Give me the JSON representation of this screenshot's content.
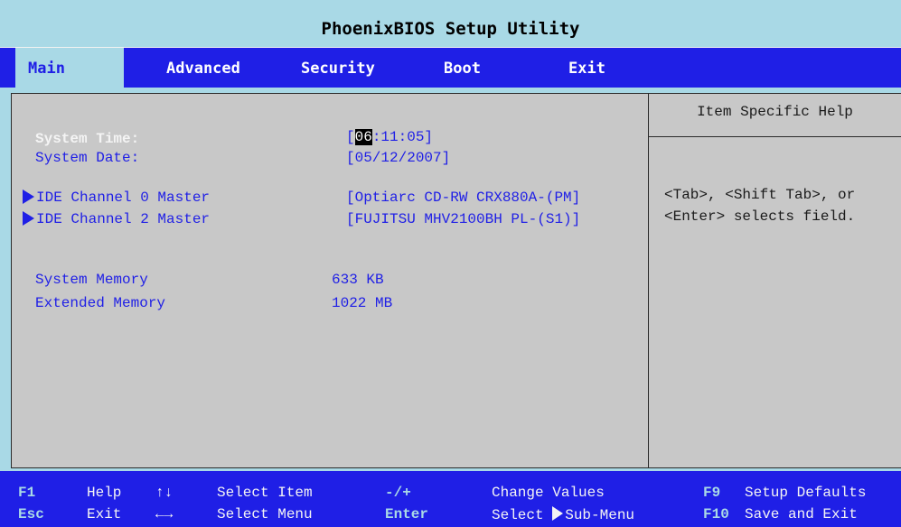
{
  "title": "PhoenixBIOS Setup Utility",
  "tabs": [
    {
      "label": "Main",
      "active": true
    },
    {
      "label": "Advanced",
      "active": false
    },
    {
      "label": "Security",
      "active": false
    },
    {
      "label": "Boot",
      "active": false
    },
    {
      "label": "Exit",
      "active": false
    }
  ],
  "settings": {
    "system_time": {
      "label": "System Time:",
      "open": "[",
      "cursor": "06",
      "rest": ":11:05]"
    },
    "system_date": {
      "label": "System Date:",
      "value": "[05/12/2007]"
    },
    "ide0": {
      "label": "IDE Channel 0 Master",
      "value": "[Optiarc CD-RW CRX880A-(PM]"
    },
    "ide2": {
      "label": "IDE Channel 2 Master",
      "value": "[FUJITSU MHV2100BH PL-(S1)]"
    },
    "system_memory": {
      "label": "System Memory",
      "value": "633 KB"
    },
    "extended_memory": {
      "label": "Extended Memory",
      "value": "1022 MB"
    }
  },
  "help": {
    "title": "Item Specific Help",
    "line1": "<Tab>, <Shift Tab>, or",
    "line2": "<Enter> selects field."
  },
  "footer": {
    "row1": [
      {
        "key": "F1",
        "desc": "Help"
      },
      {
        "key": "↑↓",
        "desc": "Select Item"
      },
      {
        "key": "-/+",
        "desc": "Change Values"
      },
      {
        "key": "F9",
        "desc": "Setup Defaults"
      }
    ],
    "row2": [
      {
        "key": "Esc",
        "desc": "Exit"
      },
      {
        "key": "←→",
        "desc": "Select Menu"
      },
      {
        "key": "Enter",
        "desc_prefix": "Select ",
        "desc": "Sub-Menu"
      },
      {
        "key": "F10",
        "desc": "Save and Exit"
      }
    ]
  },
  "colors": {
    "background_cyan": "#a9d9e6",
    "bar_blue": "#1f1fe6",
    "panel_gray": "#c8c8c8",
    "highlight_white": "#f4f4f4"
  },
  "icons": {
    "submenu_marker": "triangle-right-icon",
    "up_down": "up-down-arrows-icon",
    "left_right": "left-right-arrows-icon"
  }
}
